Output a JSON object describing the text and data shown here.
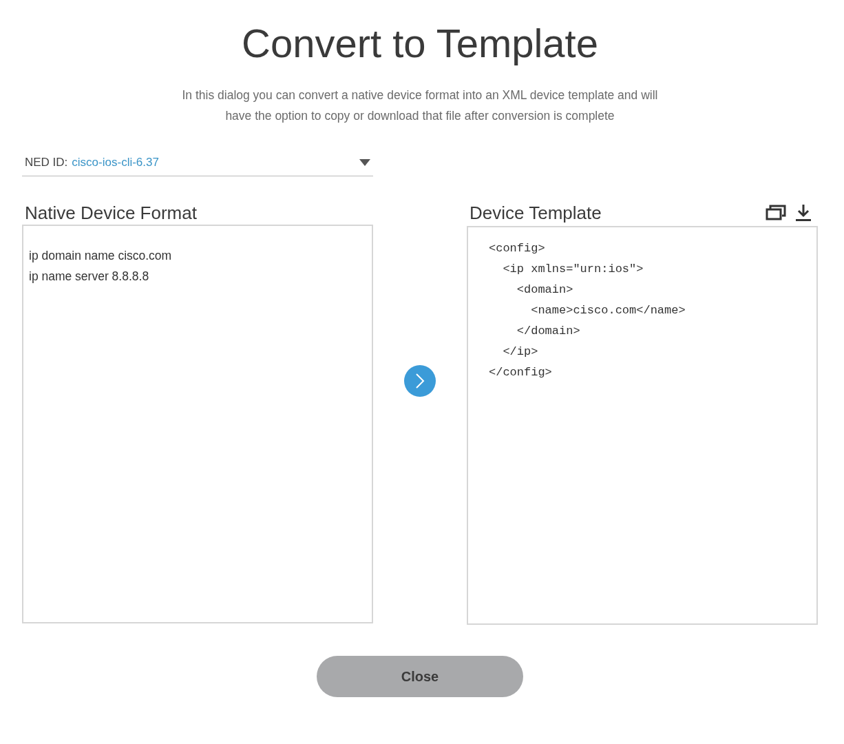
{
  "title": "Convert to Template",
  "description": [
    "In this dialog you can convert a native device format into an XML device template and will",
    "have the option to copy or download that file after conversion is complete"
  ],
  "ned_select": {
    "label": "NED ID:",
    "value": "cisco-ios-cli-6.37"
  },
  "native_panel": {
    "title": "Native Device Format",
    "lines": [
      "ip domain name cisco.com",
      "ip name server 8.8.8.8"
    ]
  },
  "template_panel": {
    "title": "Device Template",
    "lines": [
      "<config>",
      "  <ip xmlns=\"urn:ios\">",
      "    <domain>",
      "      <name>cisco.com</name>",
      "    </domain>",
      "  </ip>",
      "</config>"
    ]
  },
  "buttons": [
    {
      "label": "Close"
    }
  ]
}
